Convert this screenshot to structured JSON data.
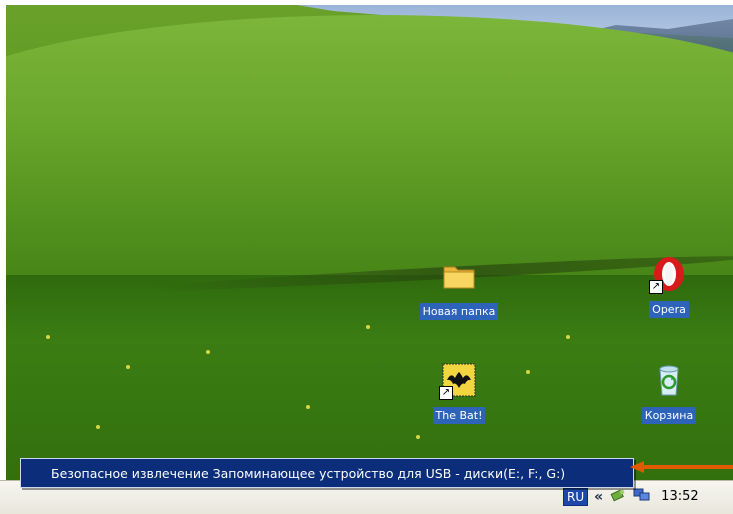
{
  "desktop": {
    "icons": [
      {
        "label": "Новая папка",
        "icon": "folder-icon"
      },
      {
        "label": "Opera",
        "icon": "opera-icon"
      },
      {
        "label": "The Bat!",
        "icon": "the-bat-icon"
      },
      {
        "label": "Корзина",
        "icon": "recycle-bin-icon"
      }
    ]
  },
  "tooltip": {
    "text": "Безопасное извлечение Запоминающее устройство для USB - диски(E:, F:, G:)"
  },
  "taskbar": {
    "language": "RU",
    "expand_symbol": "«",
    "clock": "13:52"
  },
  "colors": {
    "tooltip_bg": "#0b2d7a",
    "arrow": "#e05a00",
    "icon_label_bg": "#2d63b8"
  }
}
